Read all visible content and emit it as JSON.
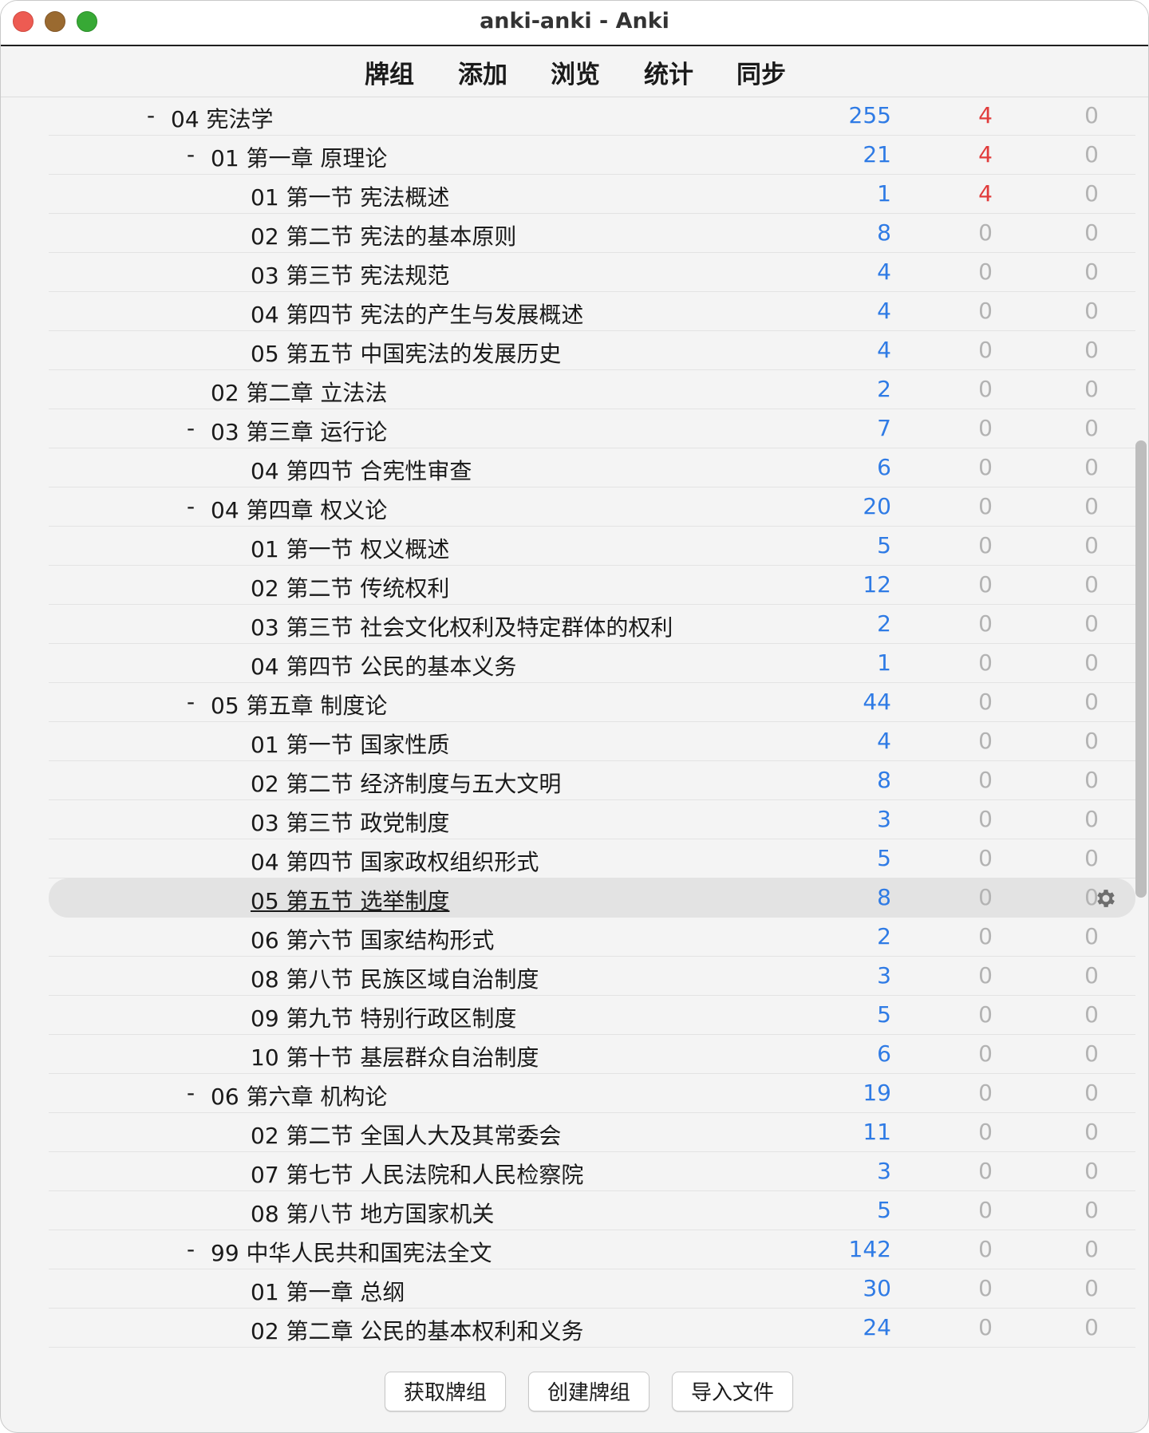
{
  "window": {
    "title": "anki-anki - Anki"
  },
  "toolbar": {
    "decks": "牌组",
    "add": "添加",
    "browse": "浏览",
    "stats": "统计",
    "sync": "同步"
  },
  "decks": [
    {
      "level": 0,
      "collapse": "-",
      "name": "04 宪法学",
      "new": "255",
      "learn": "4",
      "review": "0"
    },
    {
      "level": 1,
      "collapse": "-",
      "name": "01 第一章 原理论",
      "new": "21",
      "learn": "4",
      "review": "0"
    },
    {
      "level": 2,
      "collapse": "",
      "name": "01 第一节 宪法概述",
      "new": "1",
      "learn": "4",
      "review": "0"
    },
    {
      "level": 2,
      "collapse": "",
      "name": "02 第二节 宪法的基本原则",
      "new": "8",
      "learn": "0",
      "review": "0"
    },
    {
      "level": 2,
      "collapse": "",
      "name": "03 第三节 宪法规范",
      "new": "4",
      "learn": "0",
      "review": "0"
    },
    {
      "level": 2,
      "collapse": "",
      "name": "04 第四节 宪法的产生与发展概述",
      "new": "4",
      "learn": "0",
      "review": "0"
    },
    {
      "level": 2,
      "collapse": "",
      "name": "05 第五节 中国宪法的发展历史",
      "new": "4",
      "learn": "0",
      "review": "0"
    },
    {
      "level": 1,
      "collapse": "",
      "name": "02 第二章 立法法",
      "new": "2",
      "learn": "0",
      "review": "0"
    },
    {
      "level": 1,
      "collapse": "-",
      "name": "03 第三章 运行论",
      "new": "7",
      "learn": "0",
      "review": "0"
    },
    {
      "level": 2,
      "collapse": "",
      "name": "04 第四节 合宪性审查",
      "new": "6",
      "learn": "0",
      "review": "0"
    },
    {
      "level": 1,
      "collapse": "-",
      "name": "04 第四章 权义论",
      "new": "20",
      "learn": "0",
      "review": "0"
    },
    {
      "level": 2,
      "collapse": "",
      "name": "01 第一节 权义概述",
      "new": "5",
      "learn": "0",
      "review": "0"
    },
    {
      "level": 2,
      "collapse": "",
      "name": "02 第二节 传统权利",
      "new": "12",
      "learn": "0",
      "review": "0"
    },
    {
      "level": 2,
      "collapse": "",
      "name": "03 第三节 社会文化权利及特定群体的权利",
      "new": "2",
      "learn": "0",
      "review": "0"
    },
    {
      "level": 2,
      "collapse": "",
      "name": "04 第四节 公民的基本义务",
      "new": "1",
      "learn": "0",
      "review": "0"
    },
    {
      "level": 1,
      "collapse": "-",
      "name": "05 第五章 制度论",
      "new": "44",
      "learn": "0",
      "review": "0"
    },
    {
      "level": 2,
      "collapse": "",
      "name": "01 第一节 国家性质",
      "new": "4",
      "learn": "0",
      "review": "0"
    },
    {
      "level": 2,
      "collapse": "",
      "name": "02 第二节 经济制度与五大文明",
      "new": "8",
      "learn": "0",
      "review": "0"
    },
    {
      "level": 2,
      "collapse": "",
      "name": "03 第三节 政党制度",
      "new": "3",
      "learn": "0",
      "review": "0"
    },
    {
      "level": 2,
      "collapse": "",
      "name": "04 第四节 国家政权组织形式",
      "new": "5",
      "learn": "0",
      "review": "0"
    },
    {
      "level": 2,
      "collapse": "",
      "name": "05 第五节 选举制度",
      "new": "8",
      "learn": "0",
      "review": "0",
      "selected": true
    },
    {
      "level": 2,
      "collapse": "",
      "name": "06 第六节 国家结构形式",
      "new": "2",
      "learn": "0",
      "review": "0"
    },
    {
      "level": 2,
      "collapse": "",
      "name": "08 第八节 民族区域自治制度",
      "new": "3",
      "learn": "0",
      "review": "0"
    },
    {
      "level": 2,
      "collapse": "",
      "name": "09 第九节 特别行政区制度",
      "new": "5",
      "learn": "0",
      "review": "0"
    },
    {
      "level": 2,
      "collapse": "",
      "name": "10 第十节 基层群众自治制度",
      "new": "6",
      "learn": "0",
      "review": "0"
    },
    {
      "level": 1,
      "collapse": "-",
      "name": "06 第六章 机构论",
      "new": "19",
      "learn": "0",
      "review": "0"
    },
    {
      "level": 2,
      "collapse": "",
      "name": "02 第二节 全国人大及其常委会",
      "new": "11",
      "learn": "0",
      "review": "0"
    },
    {
      "level": 2,
      "collapse": "",
      "name": "07 第七节 人民法院和人民检察院",
      "new": "3",
      "learn": "0",
      "review": "0"
    },
    {
      "level": 2,
      "collapse": "",
      "name": "08 第八节 地方国家机关",
      "new": "5",
      "learn": "0",
      "review": "0"
    },
    {
      "level": 1,
      "collapse": "-",
      "name": "99 中华人民共和国宪法全文",
      "new": "142",
      "learn": "0",
      "review": "0"
    },
    {
      "level": 2,
      "collapse": "",
      "name": "01 第一章 总纲",
      "new": "30",
      "learn": "0",
      "review": "0"
    },
    {
      "level": 2,
      "collapse": "",
      "name": "02 第二章 公民的基本权利和义务",
      "new": "24",
      "learn": "0",
      "review": "0"
    }
  ],
  "footer": {
    "get_shared": "获取牌组",
    "create_deck": "创建牌组",
    "import_file": "导入文件"
  },
  "colors": {
    "new_count": "#2f7be5",
    "learn_count_nonzero": "#e13c3c",
    "zero_count": "#b3b3b3",
    "selected_row": "#e3e3e3"
  },
  "icons": {
    "options": "gear-icon"
  }
}
